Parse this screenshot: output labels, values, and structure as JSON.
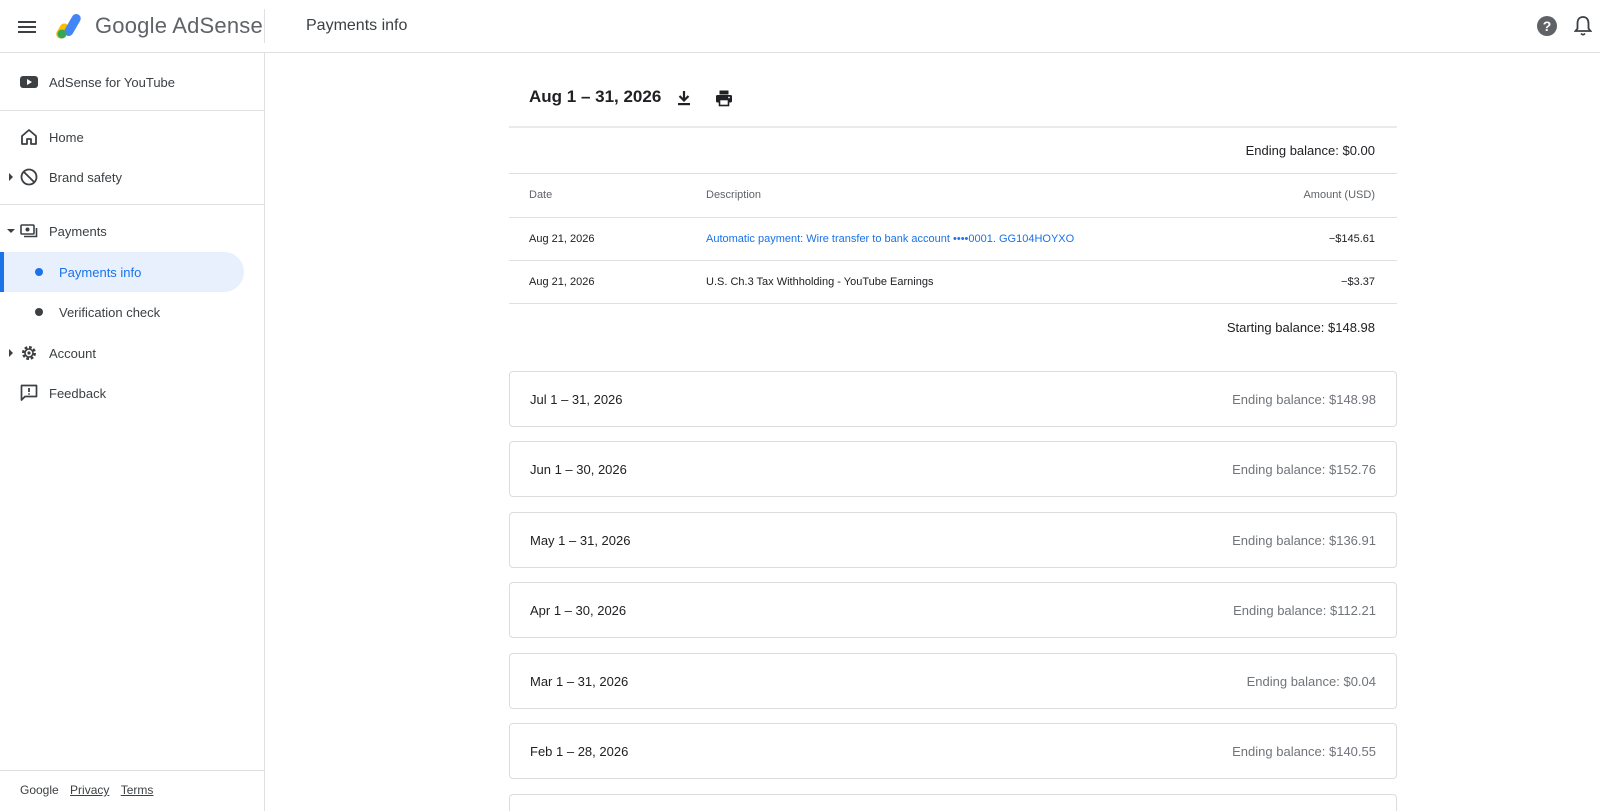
{
  "header": {
    "brand": "Google AdSense",
    "page_title": "Payments info"
  },
  "sidebar": {
    "top_item": "AdSense for YouTube",
    "items": {
      "home": "Home",
      "brand_safety": "Brand safety",
      "payments": "Payments",
      "payments_info": "Payments info",
      "verification_check": "Verification check",
      "account": "Account",
      "feedback": "Feedback"
    },
    "footer": {
      "google": "Google",
      "privacy": "Privacy",
      "terms": "Terms"
    }
  },
  "current_period": {
    "title": "Aug 1 – 31, 2026",
    "ending_balance": "Ending balance: $0.00",
    "columns": {
      "date": "Date",
      "description": "Description",
      "amount": "Amount (USD)"
    },
    "rows": [
      {
        "date": "Aug 21, 2026",
        "description": "Automatic payment: Wire transfer to bank account  ••••0001. GG104HOYXO",
        "amount": "−$145.61"
      },
      {
        "date": "Aug 21, 2026",
        "description": "U.S. Ch.3 Tax Withholding - YouTube Earnings",
        "amount": "−$3.37"
      }
    ],
    "starting_balance": "Starting balance: $148.98"
  },
  "periods": [
    {
      "label": "Jul 1 – 31, 2026",
      "balance": "Ending balance: $148.98"
    },
    {
      "label": "Jun 1 – 30, 2026",
      "balance": "Ending balance: $152.76"
    },
    {
      "label": "May 1 – 31, 2026",
      "balance": "Ending balance: $136.91"
    },
    {
      "label": "Apr 1 – 30, 2026",
      "balance": "Ending balance: $112.21"
    },
    {
      "label": "Mar 1 – 31, 2026",
      "balance": "Ending balance: $0.04"
    },
    {
      "label": "Feb 1 – 28, 2026",
      "balance": "Ending balance: $140.55"
    },
    {
      "label": "",
      "balance": ""
    }
  ],
  "colors": {
    "accent": "#1a73e8",
    "active_bg": "#e8f0fe",
    "border": "#dadce0"
  },
  "icons": {
    "menu": "menu-icon",
    "help": "help-icon",
    "notifications": "bell-icon",
    "download": "download-icon",
    "print": "print-icon"
  }
}
